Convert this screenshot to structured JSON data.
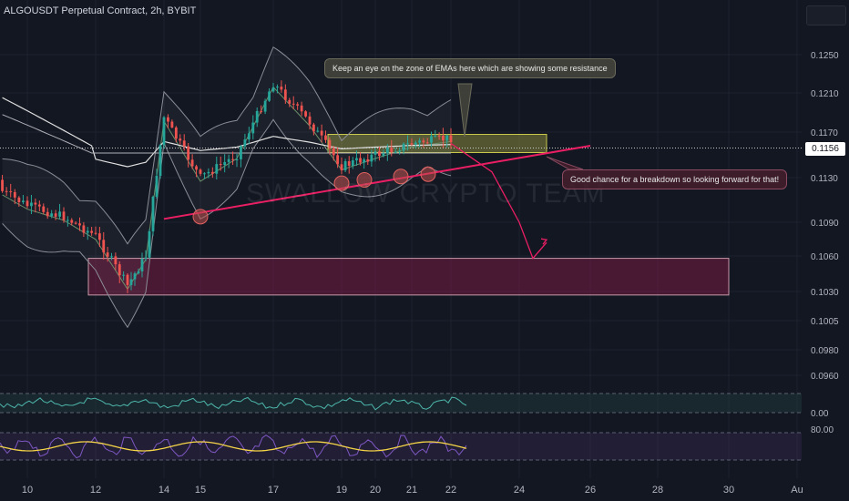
{
  "header": {
    "title": "ALGOUSDT Perpetual Contract, 2h, BYBIT"
  },
  "watermark": "SWALLOW CRYPTO TEAM",
  "annotations": {
    "ema_note": "Keep an eye on the zone of EMAs here which are showing some resistance",
    "breakdown_note": "Good chance for a breakdown so looking forward for that!"
  },
  "last_price": "0.1156",
  "colors": {
    "background": "#131722",
    "up_candle": "#26a69a",
    "down_candle": "#ef5350",
    "trendline": "#e91e63",
    "demand_zone": "#8b1a4a",
    "resistance_zone": "#c8c84a",
    "rsi_line": "#f5d547",
    "stoch_line": "#7e57c2"
  },
  "chart_data": {
    "type": "line",
    "title": "ALGOUSDT Perpetual Contract, 2h, BYBIT",
    "y_ticks": [
      "0.1250",
      "0.1210",
      "0.1170",
      "0.1130",
      "0.1090",
      "0.1060",
      "0.1030",
      "0.1005",
      "0.0980",
      "0.0960"
    ],
    "x_ticks": [
      "10",
      "12",
      "14",
      "15",
      "17",
      "19",
      "20",
      "21",
      "22",
      "24",
      "26",
      "28",
      "30",
      "Au"
    ],
    "price_path": [
      {
        "x": "8",
        "y": 0.1128
      },
      {
        "x": "9",
        "y": 0.112
      },
      {
        "x": "10",
        "y": 0.1105
      },
      {
        "x": "11",
        "y": 0.1095
      },
      {
        "x": "12",
        "y": 0.1078
      },
      {
        "x": "13",
        "y": 0.1035
      },
      {
        "x": "13.5",
        "y": 0.106
      },
      {
        "x": "14",
        "y": 0.1185
      },
      {
        "x": "15",
        "y": 0.113
      },
      {
        "x": "16",
        "y": 0.115
      },
      {
        "x": "17",
        "y": 0.122
      },
      {
        "x": "18",
        "y": 0.118
      },
      {
        "x": "19",
        "y": 0.114
      },
      {
        "x": "20",
        "y": 0.115
      },
      {
        "x": "21",
        "y": 0.116
      },
      {
        "x": "22",
        "y": 0.1165
      }
    ],
    "projection": [
      {
        "x": "22",
        "y": 0.116
      },
      {
        "x": "23",
        "y": 0.1135
      },
      {
        "x": "24",
        "y": 0.109
      },
      {
        "x": "24.5",
        "y": 0.1058
      },
      {
        "x": "25",
        "y": 0.1072
      }
    ],
    "ascending_trendline": [
      {
        "x": "14",
        "y": 0.1093
      },
      {
        "x": "26",
        "y": 0.1158
      }
    ],
    "resistance_zone": {
      "x_start": "19",
      "x_end": "25",
      "y_low": 0.1152,
      "y_high": 0.1168
    },
    "demand_zone": {
      "x_start": "11",
      "x_end": "30",
      "y_low": 0.1027,
      "y_high": 0.1058
    },
    "pivot_lows": [
      {
        "x": "15",
        "y": 0.1095
      },
      {
        "x": "19",
        "y": 0.1125
      },
      {
        "x": "19.8",
        "y": 0.1128
      },
      {
        "x": "20.7",
        "y": 0.1131
      },
      {
        "x": "21.6",
        "y": 0.1133
      }
    ],
    "last_price": 0.1156,
    "ylim": [
      0.095,
      0.1275
    ],
    "indicator_labels": [
      "0.00",
      "80.00"
    ]
  }
}
